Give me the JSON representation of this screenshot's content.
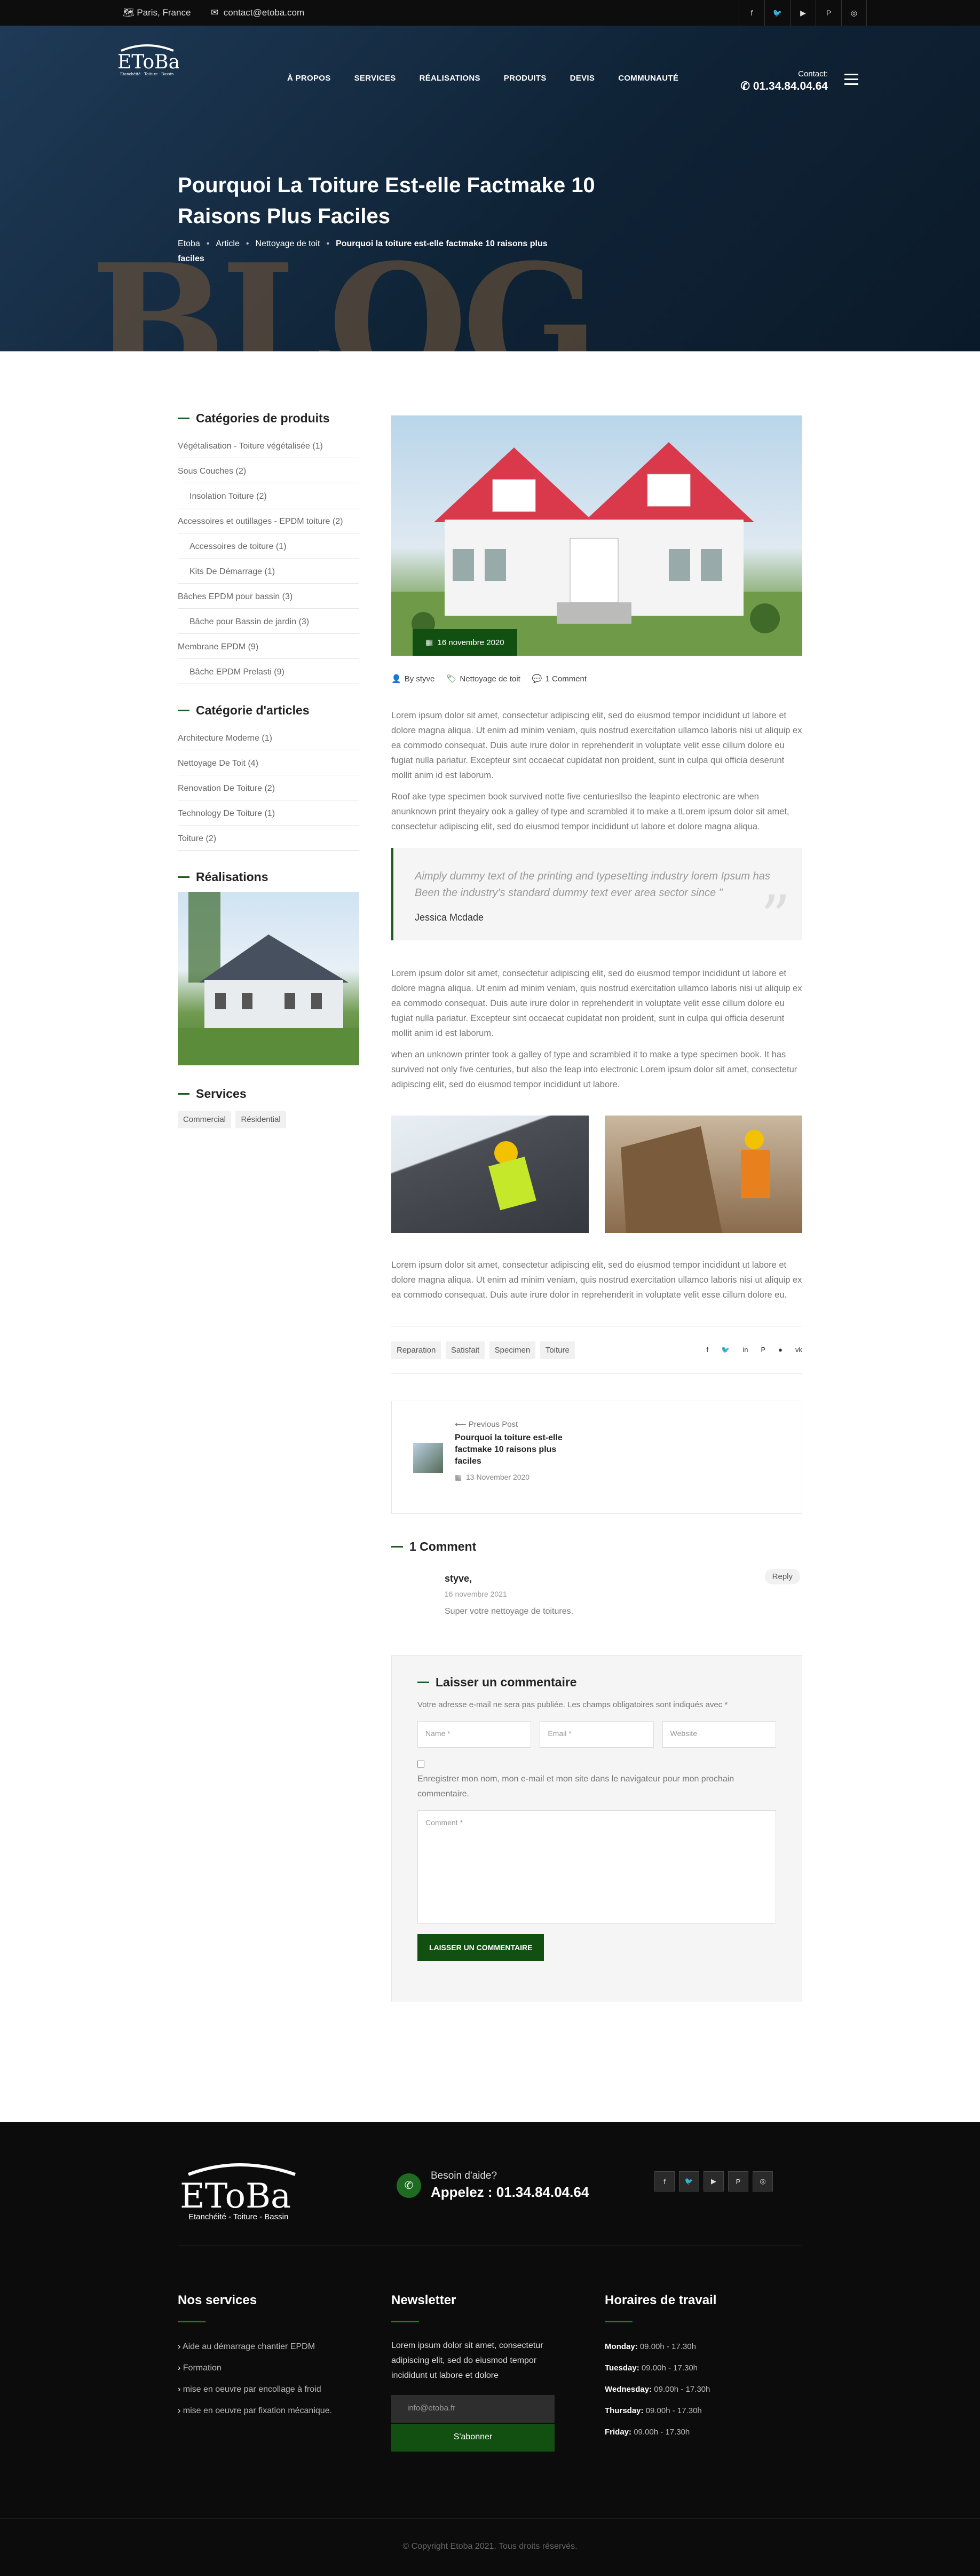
{
  "topbar": {
    "location": "Paris, France",
    "email": "contact@etoba.com",
    "social": [
      "f",
      "tw",
      "yt",
      "p",
      "ig"
    ]
  },
  "header": {
    "logo": "EToBa",
    "logo_tagline": "Etanchéité · Toiture · Bassin",
    "nav": [
      "À PROPOS",
      "SERVICES",
      "RÉALISATIONS",
      "PRODUITS",
      "DEVIS",
      "COMMUNAUTÉ"
    ],
    "contact_label": "Contact:",
    "contact_phone": "01.34.84.04.64"
  },
  "hero": {
    "bg_text": "BLOG",
    "title": "Pourquoi La Toiture Est-elle Factmake 10 Raisons Plus Faciles",
    "breadcrumb": [
      "Etoba",
      "Article",
      "Nettoyage de toit"
    ],
    "breadcrumb_current": "Pourquoi la toiture est-elle factmake 10 raisons plus faciles"
  },
  "sidebar": {
    "cat_title": "Catégories de produits",
    "categories": [
      {
        "label": "Végétalisation - Toiture végétalisée (1)",
        "sub": false
      },
      {
        "label": "Sous Couches (2)",
        "sub": false
      },
      {
        "label": "Insolation Toiture (2)",
        "sub": true
      },
      {
        "label": "Accessoires et outillages - EPDM toiture (2)",
        "sub": false
      },
      {
        "label": "Accessoires de toiture (1)",
        "sub": true
      },
      {
        "label": "Kits De Démarrage (1)",
        "sub": true
      },
      {
        "label": "Bâches EPDM pour bassin (3)",
        "sub": false
      },
      {
        "label": "Bâche pour Bassin de jardin (3)",
        "sub": true
      },
      {
        "label": "Membrane EPDM (9)",
        "sub": false
      },
      {
        "label": "Bâche EPDM Prelasti (9)",
        "sub": true
      }
    ],
    "art_title": "Catégorie d'articles",
    "articles": [
      "Architecture Moderne (1)",
      "Nettoyage De Toit (4)",
      "Renovation De Toiture (2)",
      "Technology De Toiture (1)",
      "Toiture (2)"
    ],
    "real_title": "Réalisations",
    "services_title": "Services",
    "services": [
      "Commercial",
      "Résidential"
    ]
  },
  "post": {
    "date": "16 novembre 2020",
    "author": "By styve",
    "category": "Nettoyage de toit",
    "comments": "1 Comment",
    "p1": "Lorem ipsum dolor sit amet, consectetur adipiscing elit, sed do eiusmod tempor incididunt ut labore et dolore magna aliqua. Ut enim ad minim veniam, quis nostrud exercitation ullamco laboris nisi ut aliquip ex ea commodo consequat. Duis aute irure dolor in reprehenderit in voluptate velit esse cillum dolore eu fugiat nulla pariatur. Excepteur sint occaecat cupidatat non proident, sunt in culpa qui officia deserunt mollit anim id est laborum.",
    "p2": "Roof ake type specimen book survived notte five centuriesllso the leapinto electronic are when anunknown print theyairy ook a galley of type and scrambled it to make a tLorem ipsum dolor sit amet, consectetur adipiscing elit, sed do eiusmod tempor incididunt ut labore et dolore magna aliqua.",
    "quote": "Aimply dummy text of the printing and typesetting industry lorem Ipsum has Been the industry's standard dummy text ever area sector since \"",
    "quote_author": "Jessica Mcdade",
    "p3": "Lorem ipsum dolor sit amet, consectetur adipiscing elit, sed do eiusmod tempor incididunt ut labore et dolore magna aliqua. Ut enim ad minim veniam, quis nostrud exercitation ullamco laboris nisi ut aliquip ex ea commodo consequat. Duis aute irure dolor in reprehenderit in voluptate velit esse cillum dolore eu fugiat nulla pariatur. Excepteur sint occaecat cupidatat non proident, sunt in culpa qui officia deserunt mollit anim id est laborum.",
    "p4": "when an unknown printer took a galley of type and scrambled it to make a type specimen book. It has survived not only five centuries, but also the leap into electronic Lorem ipsum dolor sit amet, consectetur adipiscing elit, sed do eiusmod tempor incididunt ut labore.",
    "p5": "Lorem ipsum dolor sit amet, consectetur adipiscing elit, sed do eiusmod tempor incididunt ut labore et dolore magna aliqua. Ut enim ad minim veniam, quis nostrud exercitation ullamco laboris nisi ut aliquip ex ea commodo consequat. Duis aute irure dolor in reprehenderit in voluptate velit esse cillum dolore eu.",
    "tags": [
      "Reparation",
      "Satisfait",
      "Specimen",
      "Toiture"
    ],
    "share": [
      "f",
      "tw",
      "in",
      "p",
      "r",
      "vk"
    ],
    "prev_label": "Previous Post",
    "prev_title": "Pourquoi la toiture est-elle factmake 10 raisons plus faciles",
    "prev_date": "13 November 2020"
  },
  "comments": {
    "title": "1 Comment",
    "author": "styve,",
    "date": "16 novembre 2021",
    "text": "Super votre nettoyage de toitures.",
    "reply": "Reply"
  },
  "form": {
    "title": "Laisser un commentaire",
    "note": "Votre adresse e-mail ne sera pas publiée. Les champs obligatoires sont indiqués avec *",
    "name_ph": "Name *",
    "email_ph": "Email *",
    "website_ph": "Website",
    "save_label": "Enregistrer mon nom, mon e-mail et mon site dans le navigateur pour mon prochain commentaire.",
    "comment_ph": "Comment *",
    "submit": "LAISSER UN COMMENTAIRE"
  },
  "footer": {
    "logo": "EToBa",
    "logo_tagline": "Etanchéité - Toiture - Bassin",
    "help_label": "Besoin d'aide?",
    "help_phone": "Appelez : 01.34.84.04.64",
    "social": [
      "f",
      "tw",
      "yt",
      "p",
      "ig"
    ],
    "services_title": "Nos services",
    "services": [
      "Aide au démarrage chantier EPDM",
      "Formation",
      "mise en oeuvre par encollage à froid",
      "mise en oeuvre par fixation mécanique."
    ],
    "newsletter_title": "Newsletter",
    "newsletter_text": "Lorem ipsum dolor sit amet, consectetur adipiscing elit, sed do eiusmod tempor incididunt ut labore et dolore",
    "newsletter_ph": "info@etoba.fr",
    "subscribe": "S'abonner",
    "hours_title": "Horaires de travail",
    "hours": [
      {
        "day": "Monday:",
        "time": "09.00h - 17.30h"
      },
      {
        "day": "Tuesday:",
        "time": "09.00h - 17.30h"
      },
      {
        "day": "Wednesday:",
        "time": "09.00h - 17.30h"
      },
      {
        "day": "Thursday:",
        "time": "09.00h - 17.30h"
      },
      {
        "day": "Friday:",
        "time": "09.00h - 17.30h"
      }
    ],
    "copyright": "© Copyright Etoba 2021. Tous droits réservés."
  }
}
